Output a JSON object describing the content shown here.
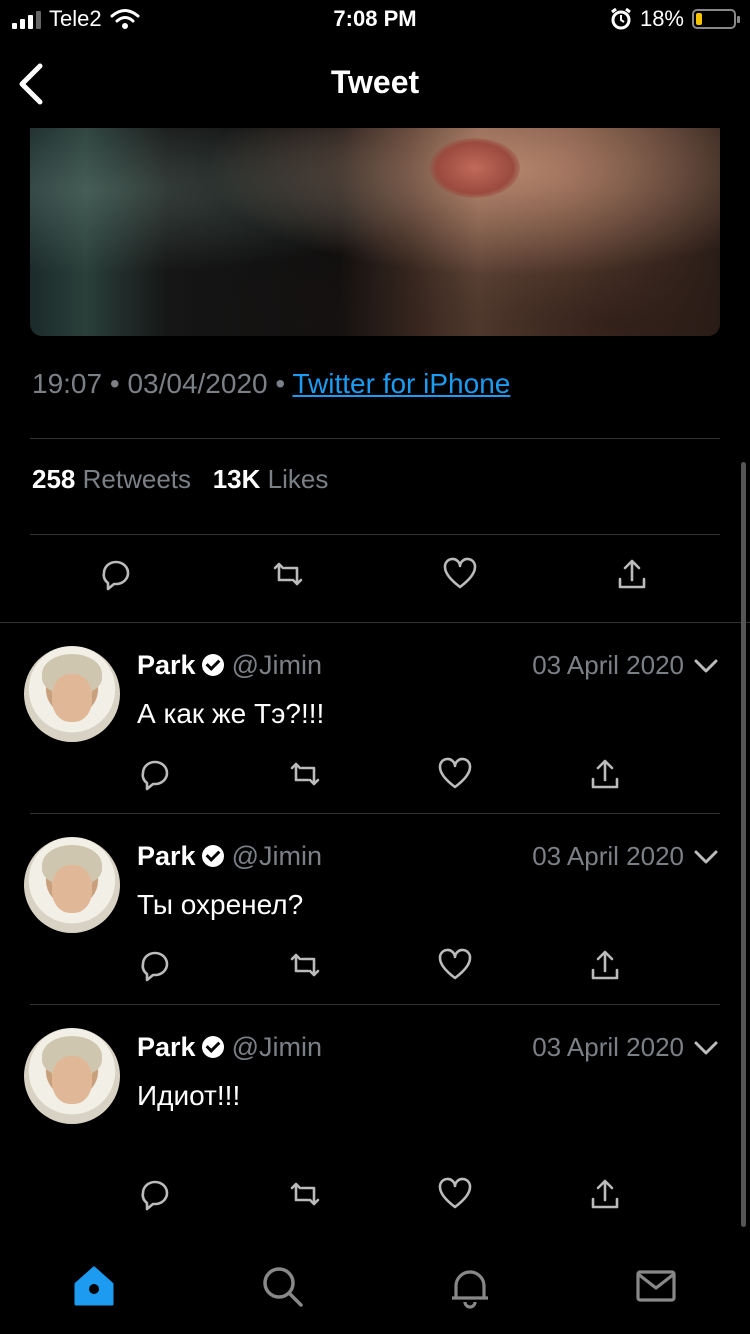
{
  "status": {
    "carrier": "Tele2",
    "time": "7:08 PM",
    "battery": "18%",
    "battery_level": 0.18
  },
  "nav": {
    "title": "Tweet"
  },
  "tweet": {
    "time": "19:07",
    "date": "03/04/2020",
    "separator": "•",
    "source": "Twitter for iPhone",
    "retweets_count": "258",
    "retweets_label": "Retweets",
    "likes_count": "13K",
    "likes_label": "Likes"
  },
  "replies": [
    {
      "name": "Park",
      "handle": "@Jimin",
      "date": "03 April 2020",
      "text": "А как же Тэ?!!!"
    },
    {
      "name": "Park",
      "handle": "@Jimin",
      "date": "03 April 2020",
      "text": "Ты охренел?"
    },
    {
      "name": "Park",
      "handle": "@Jimin",
      "date": "03 April 2020",
      "text": "Идиот!!!"
    }
  ],
  "colors": {
    "accent": "#1d9bf0",
    "muted": "#7a8086",
    "divider": "#2f3336"
  },
  "tabs": [
    "home-icon",
    "search-icon",
    "notifications-icon",
    "messages-icon"
  ]
}
